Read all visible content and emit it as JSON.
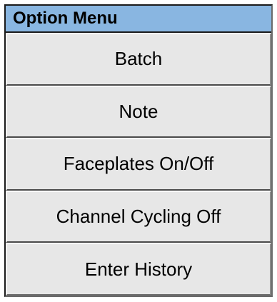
{
  "menu": {
    "title": "Option Menu",
    "items": [
      {
        "label": "Batch"
      },
      {
        "label": "Note"
      },
      {
        "label": "Faceplates On/Off"
      },
      {
        "label": "Channel Cycling Off"
      },
      {
        "label": "Enter History"
      }
    ]
  }
}
